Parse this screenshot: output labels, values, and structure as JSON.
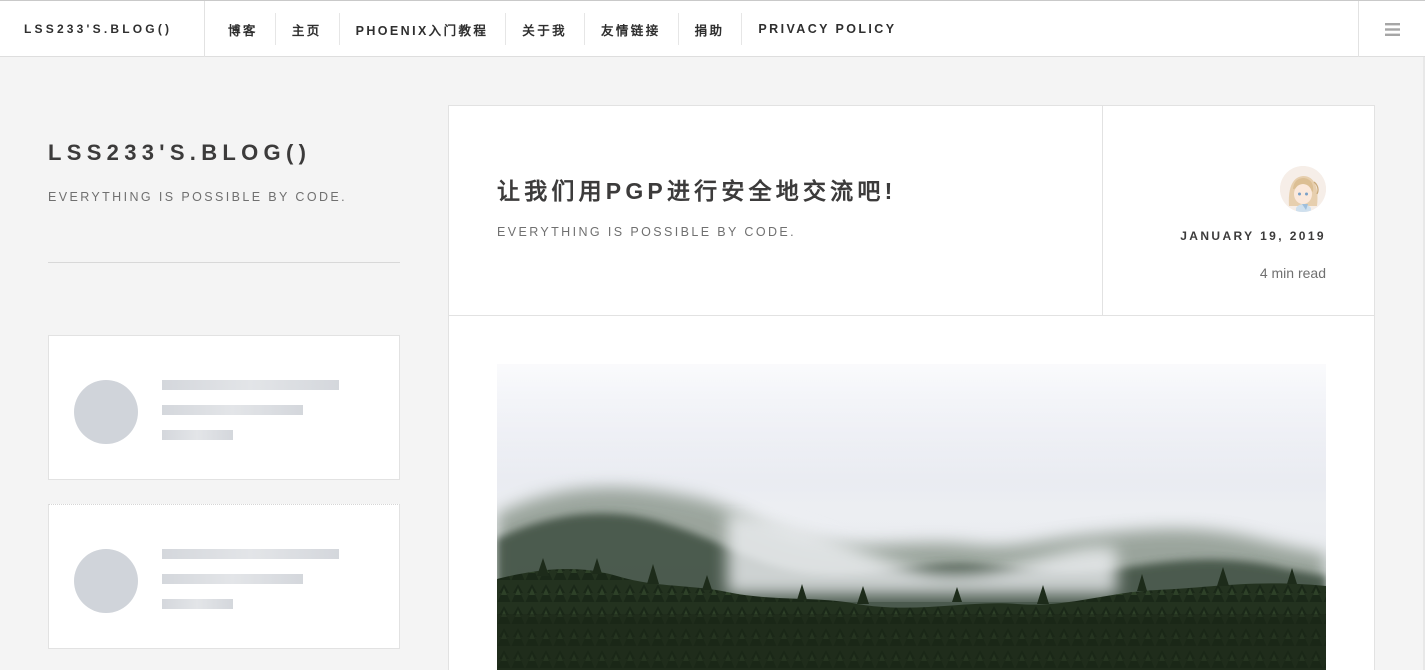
{
  "header": {
    "brand": "LSS233'S.BLOG()",
    "nav": [
      {
        "label": "博客"
      },
      {
        "label": "主页"
      },
      {
        "label": "PHOENIX入门教程"
      },
      {
        "label": "关于我"
      },
      {
        "label": "友情链接"
      },
      {
        "label": "捐助"
      },
      {
        "label": "PRIVACY POLICY"
      }
    ],
    "menu_icon": "hamburger-menu-icon"
  },
  "sidebar": {
    "title": "LSS233'S.BLOG()",
    "subtitle": "EVERYTHING IS POSSIBLE BY CODE."
  },
  "post": {
    "title": "让我们用PGP进行安全地交流吧!",
    "subtitle": "EVERYTHING IS POSSIBLE BY CODE.",
    "date": "JANUARY 19, 2019",
    "read_time": "4 min read"
  },
  "colors": {
    "page_bg": "#f4f4f4",
    "card_bg": "#ffffff",
    "text": "#3c3b3b",
    "muted": "#707070",
    "placeholder": "#d0d4da"
  }
}
